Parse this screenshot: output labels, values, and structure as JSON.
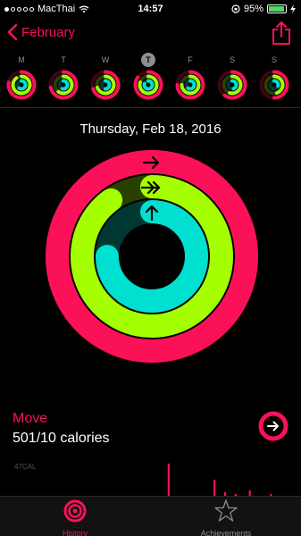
{
  "status_bar": {
    "carrier": "MacThai",
    "time": "14:57",
    "battery": "95%",
    "battery_level": 0.95
  },
  "nav": {
    "back_label": "February",
    "accent_color": "#fa1158",
    "back_icon": "chevron-left-icon",
    "share_icon": "share-icon"
  },
  "week": {
    "days": [
      {
        "label": "M",
        "move": 0.78,
        "exercise": 0.9,
        "stand": 0.6,
        "today": false
      },
      {
        "label": "T",
        "move": 0.72,
        "exercise": 0.6,
        "stand": 0.55,
        "today": false
      },
      {
        "label": "W",
        "move": 0.7,
        "exercise": 0.7,
        "stand": 0.5,
        "today": false
      },
      {
        "label": "T",
        "move": 0.85,
        "exercise": 0.8,
        "stand": 0.8,
        "today": true
      },
      {
        "label": "F",
        "move": 0.75,
        "exercise": 0.75,
        "stand": 0.6,
        "today": false
      },
      {
        "label": "S",
        "move": 0.6,
        "exercise": 0.55,
        "stand": 0.45,
        "today": false
      },
      {
        "label": "S",
        "move": 0.5,
        "exercise": 0.45,
        "stand": 0.3,
        "today": false
      }
    ]
  },
  "summary": {
    "date": "Thursday, Feb 18, 2016",
    "rings": {
      "move_progress": 1.0,
      "exercise_progress": 0.9,
      "stand_progress": 0.75,
      "move_color": "#fa1158",
      "exercise_color": "#a6ff00",
      "stand_color": "#00e0d0"
    }
  },
  "move": {
    "title": "Move",
    "value": "501/10 calories",
    "chart_label": "47CAL",
    "bars": [
      0,
      0,
      0,
      0,
      0,
      0,
      0,
      0,
      0,
      0,
      0,
      0,
      0,
      0,
      0,
      0,
      0,
      0,
      0,
      0,
      0,
      0,
      0,
      0,
      0,
      0,
      0,
      0,
      0,
      0,
      0,
      0,
      0,
      0,
      0,
      0,
      0,
      0,
      0,
      0,
      0,
      0,
      0,
      0,
      0.95,
      0,
      0,
      0,
      0,
      0.05,
      0,
      0,
      0,
      0.05,
      0,
      0.05,
      0,
      0.5,
      0,
      0,
      0.15,
      0,
      0,
      0.1,
      0,
      0,
      0,
      0.2,
      0,
      0,
      0,
      0,
      0,
      0.1,
      0,
      0,
      0.05,
      0
    ]
  },
  "tabs": [
    {
      "label": "History",
      "icon": "history-rings-icon",
      "active": true
    },
    {
      "label": "Achievements",
      "icon": "star-achievement-icon",
      "active": false
    }
  ]
}
